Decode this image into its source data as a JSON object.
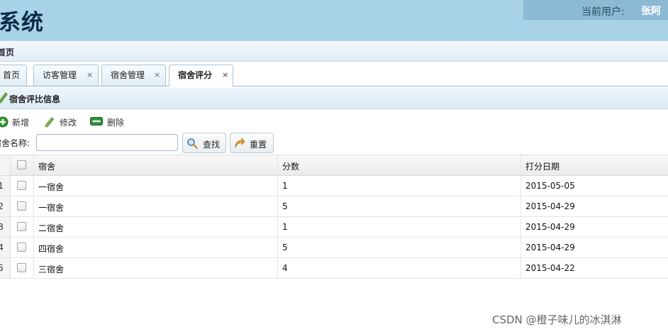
{
  "header": {
    "app_title": "系统",
    "current_user_label": "当前用户:",
    "current_user_name": "张阿"
  },
  "breadcrumb": "首页",
  "tabs": [
    {
      "label": "首页",
      "closable": false
    },
    {
      "label": "访客管理",
      "closable": true
    },
    {
      "label": "宿舍管理",
      "closable": true
    },
    {
      "label": "宿舍评分",
      "closable": true,
      "active": true
    }
  ],
  "tab_close_glyph": "×",
  "panel": {
    "title": "宿舍评比信息"
  },
  "toolbar": {
    "add_label": "新增",
    "edit_label": "修改",
    "delete_label": "删除"
  },
  "search": {
    "label": "宿舍名称:",
    "value": "",
    "placeholder": "",
    "search_button": "查找",
    "reset_button": "重置"
  },
  "table": {
    "columns": [
      "宿舍",
      "分数",
      "打分日期"
    ],
    "rows": [
      {
        "num": "1",
        "dorm": "一宿舍",
        "score": "1",
        "date": "2015-05-05"
      },
      {
        "num": "2",
        "dorm": "一宿舍",
        "score": "5",
        "date": "2015-04-29"
      },
      {
        "num": "3",
        "dorm": "二宿舍",
        "score": "1",
        "date": "2015-04-29"
      },
      {
        "num": "4",
        "dorm": "四宿舍",
        "score": "5",
        "date": "2015-04-29"
      },
      {
        "num": "5",
        "dorm": "三宿舍",
        "score": "4",
        "date": "2015-04-22"
      }
    ]
  },
  "icons": {
    "add": "plus-circle-icon",
    "edit": "pencil-icon",
    "delete": "minus-rect-icon",
    "search": "magnifier-icon",
    "reset": "reset-arrow-icon"
  },
  "colors": {
    "header_bg": "#a8d3e6",
    "title_color": "#0b2a4a",
    "add_green": "#2e9a2e",
    "delete_green": "#2f8f3a"
  },
  "watermark": "CSDN @橙子味儿的冰淇淋"
}
